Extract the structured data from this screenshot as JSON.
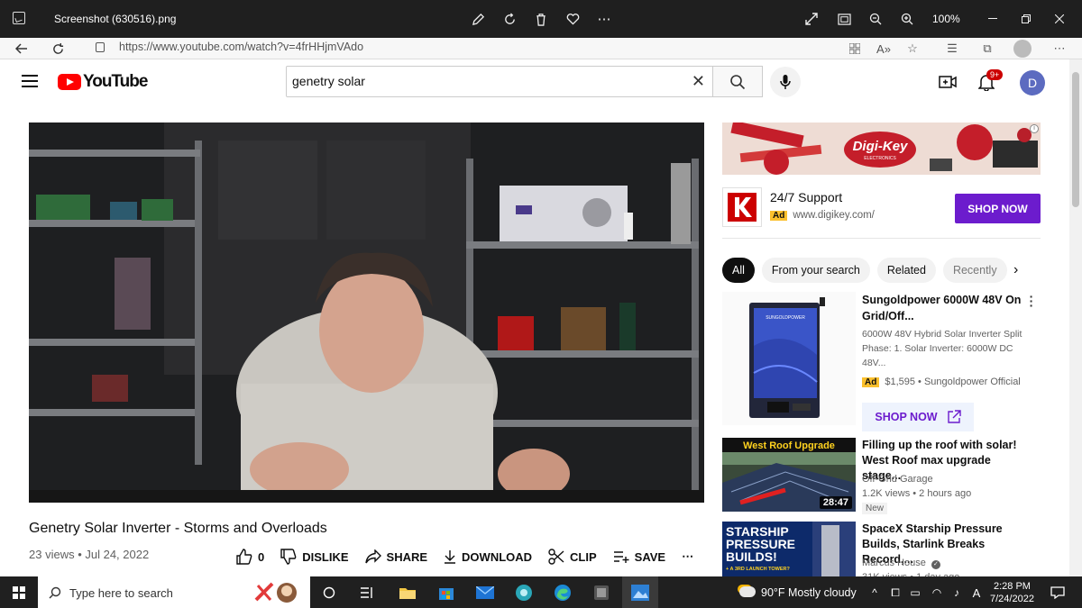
{
  "viewer": {
    "file_name": "Screenshot (630516).png",
    "zoom": "100%"
  },
  "browser": {
    "url": "https://www.youtube.com/watch?v=4frHHjmVAdo"
  },
  "header": {
    "logo_text": "YouTube",
    "search_value": "genetry solar",
    "notif_count": "9+",
    "avatar_letter": "D"
  },
  "video": {
    "title": "Genetry Solar Inverter - Storms and Overloads",
    "meta": "23 views • Jul 24, 2022",
    "actions": {
      "like_count": "0",
      "dislike": "DISLIKE",
      "share": "SHARE",
      "download": "DOWNLOAD",
      "clip": "CLIP",
      "save": "SAVE"
    }
  },
  "sidebar": {
    "banner_brand": "Digi-Key",
    "banner_sub": "ELECTRONICS",
    "ad": {
      "title": "24/7 Support",
      "tag": "Ad",
      "url": "www.digikey.com/",
      "button": "SHOP NOW"
    },
    "chips": [
      "All",
      "From your search",
      "Related",
      "Recently"
    ],
    "product": {
      "title": "Sungoldpower 6000W 48V On Grid/Off...",
      "desc": "6000W 48V Hybrid Solar Inverter Split Phase: 1. Solar Inverter: 6000W DC 48V...",
      "tag": "Ad",
      "price": "$1,595 • Sungoldpower Official",
      "button": "SHOP NOW",
      "brand": "SUNGOLDPOWER"
    },
    "recs": [
      {
        "thumb_text": "West Roof Upgrade",
        "duration": "28:47",
        "title": "Filling up the roof with solar! West Roof max upgrade stage...",
        "channel": "Off-Grid Garage",
        "meta": "1.2K views • 2 hours ago",
        "badge": "New"
      },
      {
        "thumb_text": "STARSHIP PRESSURE BUILDS!",
        "thumb_sub": "+ A 3RD LAUNCH TOWER?",
        "title": "SpaceX Starship Pressure Builds, Starlink Breaks Record,...",
        "channel": "Marcus House",
        "meta": "31K views • 1 day ago"
      }
    ]
  },
  "taskbar": {
    "search_placeholder": "Type here to search",
    "weather": "90°F  Mostly cloudy",
    "time": "2:28 PM",
    "date": "7/24/2022"
  }
}
